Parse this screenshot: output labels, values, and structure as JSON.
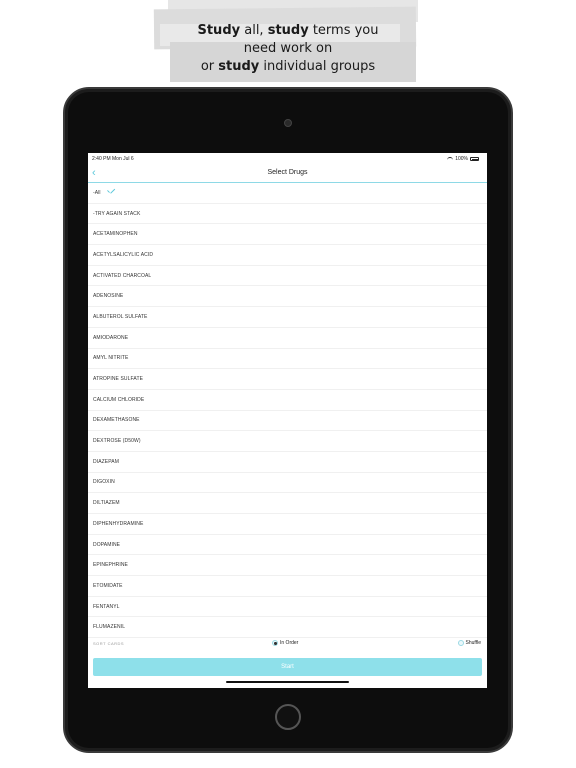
{
  "promo": {
    "line1_bold": "Study",
    "line1_mid": " all, ",
    "line1_bold2": "study",
    "line1_end": " terms you",
    "line2": "need work on",
    "line3_start": "or ",
    "line3_bold": "study",
    "line3_end": " individual groups"
  },
  "status": {
    "time": "2:40 PM   Mon Jul 6",
    "battery": "100%"
  },
  "nav": {
    "back": "‹",
    "title": "Select Drugs"
  },
  "items": [
    {
      "label": "-All",
      "selected": true
    },
    {
      "label": "-TRY AGAIN STACK",
      "selected": false
    },
    {
      "label": "ACETAMINOPHEN",
      "selected": false
    },
    {
      "label": "ACETYLSALICYLIC ACID",
      "selected": false
    },
    {
      "label": "ACTIVATED CHARCOAL",
      "selected": false
    },
    {
      "label": "ADENOSINE",
      "selected": false
    },
    {
      "label": "ALBUTEROL SULFATE",
      "selected": false
    },
    {
      "label": "AMIODARONE",
      "selected": false
    },
    {
      "label": "AMYL NITRITE",
      "selected": false
    },
    {
      "label": "ATROPINE SULFATE",
      "selected": false
    },
    {
      "label": "CALCIUM CHLORIDE",
      "selected": false
    },
    {
      "label": "DEXAMETHASONE",
      "selected": false
    },
    {
      "label": "DEXTROSE (D50W)",
      "selected": false
    },
    {
      "label": "DIAZEPAM",
      "selected": false
    },
    {
      "label": "DIGOXIN",
      "selected": false
    },
    {
      "label": "DILTIAZEM",
      "selected": false
    },
    {
      "label": "DIPHENHYDRAMINE",
      "selected": false
    },
    {
      "label": "DOPAMINE",
      "selected": false
    },
    {
      "label": "EPINEPHRINE",
      "selected": false
    },
    {
      "label": "ETOMIDATE",
      "selected": false
    },
    {
      "label": "FENTANYL",
      "selected": false
    },
    {
      "label": "FLUMAZENIL",
      "selected": false
    }
  ],
  "sort": {
    "label": "SORT CARDS",
    "in_order": "In Order",
    "shuffle": "Shuffle",
    "selected": "In Order"
  },
  "start_label": "Start",
  "colors": {
    "accent": "#5ac8da",
    "button": "#8ee0ea"
  }
}
